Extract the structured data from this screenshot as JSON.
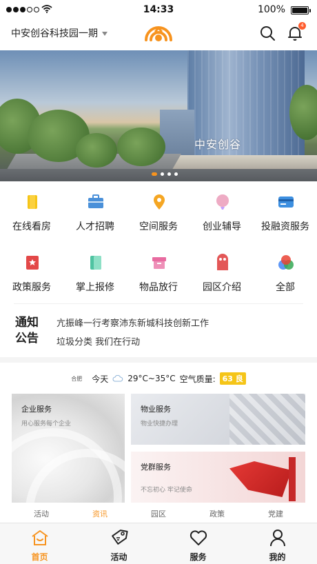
{
  "status_bar": {
    "time": "14:33",
    "battery": "100%"
  },
  "header": {
    "park_name": "中安创谷科技园一期",
    "notification_count": "4"
  },
  "banner": {
    "sign_text": "中安创谷",
    "slide_count": 4,
    "active_slide": 1
  },
  "services": [
    {
      "label": "在线看房",
      "icon": "house-viewing-icon",
      "color": "#f5c518"
    },
    {
      "label": "人才招聘",
      "icon": "briefcase-icon",
      "color": "#4a90d9"
    },
    {
      "label": "空间服务",
      "icon": "location-pin-icon",
      "color": "#f5a623"
    },
    {
      "label": "创业辅导",
      "icon": "balloon-icon",
      "color": "#e88fb0"
    },
    {
      "label": "投融资服务",
      "icon": "card-icon",
      "color": "#3d8fe0"
    },
    {
      "label": "政策服务",
      "icon": "star-badge-icon",
      "color": "#e34848"
    },
    {
      "label": "掌上报修",
      "icon": "repair-icon",
      "color": "#4fc3a1"
    },
    {
      "label": "物品放行",
      "icon": "box-icon",
      "color": "#e86ba0"
    },
    {
      "label": "园区介绍",
      "icon": "intro-icon",
      "color": "#e35757"
    },
    {
      "label": "全部",
      "icon": "all-icon",
      "color": "#34a853"
    }
  ],
  "notice": {
    "title_line1": "通知",
    "title_line2": "公告",
    "items": [
      "亢振峰一行考察沛东新城科技创新工作",
      "垃圾分类  我们在行动"
    ]
  },
  "weather": {
    "city": "合肥",
    "day": "今天",
    "temp": "29°C~35°C",
    "aq_label": "空气质量:",
    "aq_value": "63 良"
  },
  "cards": {
    "enterprise": {
      "title": "企业服务",
      "subtitle": "用心服务每个企业"
    },
    "property": {
      "title": "物业服务",
      "subtitle": "物业快捷办理"
    },
    "party": {
      "title": "党群服务",
      "subtitle": "不忘初心 牢记使命"
    }
  },
  "subtabs": [
    "活动",
    "资讯",
    "园区",
    "政策",
    "党建"
  ],
  "subtab_active": 1,
  "bottom_nav": [
    "首页",
    "活动",
    "服务",
    "我的"
  ],
  "colors": {
    "accent": "#f7931e",
    "badge": "#ff5c2e",
    "aqi": "#f5c518"
  }
}
